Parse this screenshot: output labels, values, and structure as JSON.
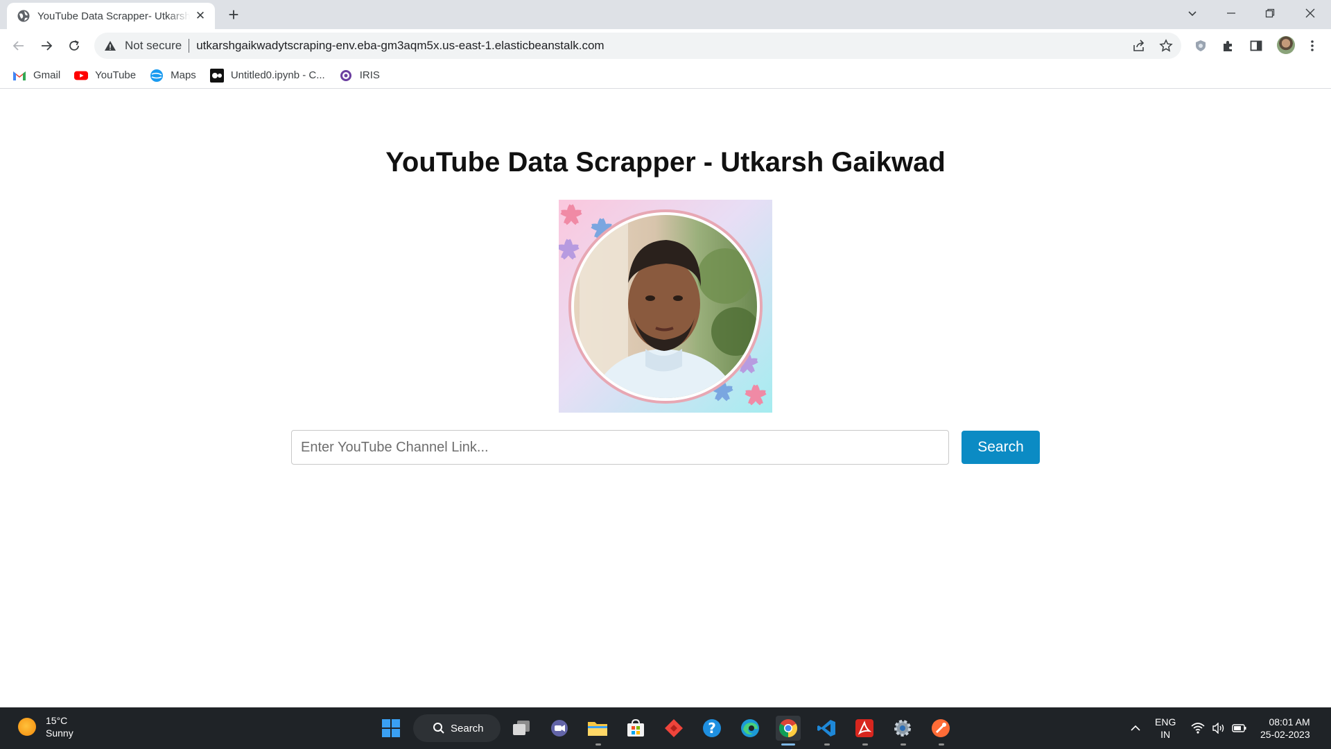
{
  "browser": {
    "tab_title": "YouTube Data Scrapper- Utkarsh Gaikwad",
    "address": {
      "security_label": "Not secure",
      "url": "utkarshgaikwadytscraping-env.eba-gm3aqm5x.us-east-1.elasticbeanstalk.com"
    },
    "bookmarks": [
      {
        "label": "Gmail",
        "icon": "gmail-icon"
      },
      {
        "label": "YouTube",
        "icon": "youtube-icon"
      },
      {
        "label": "Maps",
        "icon": "maps-icon"
      },
      {
        "label": "Untitled0.ipynb - C...",
        "icon": "colab-icon"
      },
      {
        "label": "IRIS",
        "icon": "iris-icon"
      }
    ]
  },
  "page": {
    "title": "YouTube Data Scrapper - Utkarsh Gaikwad",
    "search": {
      "placeholder": "Enter YouTube Channel Link...",
      "button_label": "Search"
    }
  },
  "taskbar": {
    "weather": {
      "temperature": "15°C",
      "condition": "Sunny"
    },
    "search_label": "Search",
    "language": {
      "line1": "ENG",
      "line2": "IN"
    },
    "clock": {
      "time": "08:01 AM",
      "date": "25-02-2023"
    }
  },
  "colors": {
    "accent": "#0b8bc4",
    "tabstrip": "#dee1e6",
    "taskbar": "#1f2327"
  }
}
